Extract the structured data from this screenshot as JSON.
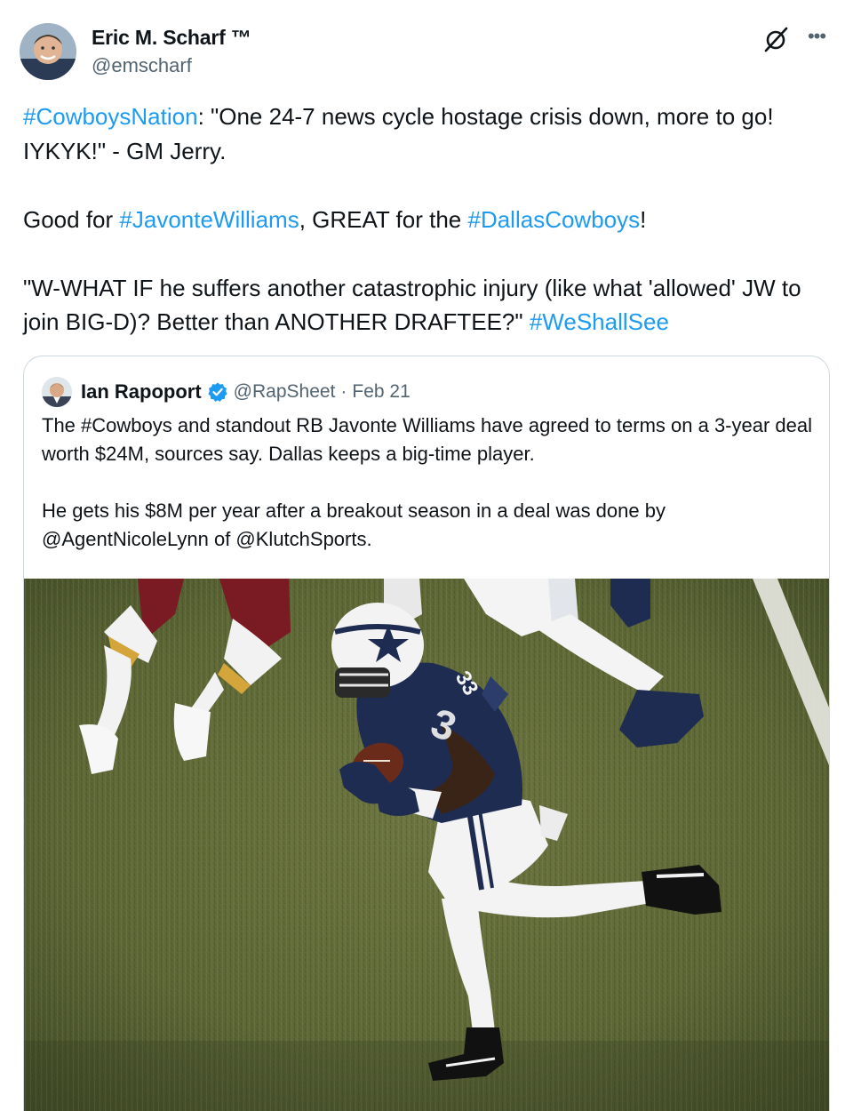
{
  "author": {
    "display_name": "Eric M. Scharf ™",
    "handle": "@emscharf"
  },
  "actions": {
    "grok_icon": "grok-icon",
    "more_icon": "more-icon"
  },
  "tweet": {
    "p1_tag": "#CowboysNation",
    "p1_rest": ": \"One 24-7 news cycle hostage crisis down, more to go! IYKYK!\" - GM Jerry.",
    "p2_pre": "Good for ",
    "p2_tag1": "#JavonteWilliams",
    "p2_mid": ", GREAT for the ",
    "p2_tag2": "#DallasCowboys",
    "p2_end": "!",
    "p3_text": "\"W-WHAT IF he suffers another catastrophic injury (like what 'allowed' JW to join BIG-D)? Better than ANOTHER DRAFTEE?\" ",
    "p3_tag": "#WeShallSee"
  },
  "quote": {
    "name": "Ian Rapoport",
    "handle": "@RapSheet",
    "separator": "·",
    "date": "Feb 21",
    "para1": "The #Cowboys and standout RB Javonte Williams have agreed to terms on a 3-year deal worth $24M, sources say. Dallas keeps a big-time player.",
    "para2": "He gets his $8M per year after a breakout season in a deal was done by @AgentNicoleLynn of @KlutchSports.",
    "jersey_number": "33"
  },
  "colors": {
    "link": "#1d9bf0",
    "secondary_text": "#536471",
    "verified": "#1d9bf0",
    "turf": "#5f6a3a",
    "cowboys_navy": "#1f2c52"
  }
}
